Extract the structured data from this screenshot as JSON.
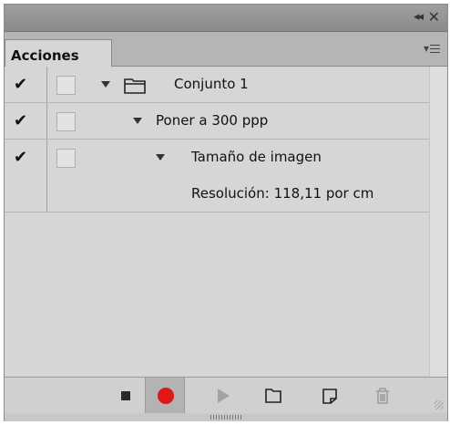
{
  "panel": {
    "tab_label": "Acciones",
    "colors": {
      "record": "#e01818",
      "panel_bg": "#d6d6d6",
      "titlebar": "#959595"
    }
  },
  "titlebar": {
    "collapse_glyph": "◂◂",
    "close_glyph": "✕",
    "icons": [
      "collapse-icon",
      "close-icon"
    ]
  },
  "actions": [
    {
      "checked": true,
      "dialog": false,
      "expanded": true,
      "type": "set",
      "label": "Conjunto 1",
      "icon": "folder-icon"
    },
    {
      "checked": true,
      "dialog": false,
      "expanded": true,
      "type": "action",
      "label": "Poner a 300 ppp"
    },
    {
      "checked": true,
      "dialog": false,
      "expanded": true,
      "type": "command",
      "label": "Tamaño de imagen"
    },
    {
      "type": "detail",
      "label": "Resolución: 118,11 por cm"
    }
  ],
  "check_glyph": "✔",
  "toolbar": {
    "buttons": [
      "stop-icon",
      "record-icon",
      "play-icon",
      "new-set-icon",
      "new-action-icon",
      "delete-icon"
    ]
  }
}
